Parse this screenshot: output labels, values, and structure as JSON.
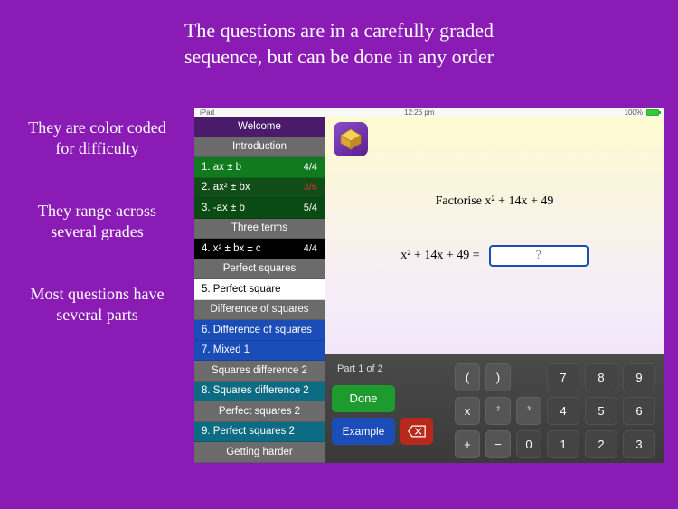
{
  "headline_l1": "The questions are in a carefully graded",
  "headline_l2": "sequence, but can be done in any order",
  "blurbs": {
    "b1": "They are color coded for difficulty",
    "b2": "They range across several grades",
    "b3": "Most questions have several parts"
  },
  "statusbar": {
    "device": "iPad",
    "wifi": "●",
    "time": "12:26 pm",
    "battery": "100%"
  },
  "sidebar": {
    "welcome": "Welcome",
    "sections": [
      {
        "header": "Introduction",
        "items": [
          {
            "label": "1. ax ± b",
            "score": "4/4",
            "color": "green"
          },
          {
            "label": "2. ax² ± bx",
            "score": "3/6",
            "scoreRed": true,
            "color": "darkgreen"
          },
          {
            "label": "3. -ax ± b",
            "score": "5/4",
            "color": "deepgreen"
          }
        ]
      },
      {
        "header": "Three terms",
        "items": [
          {
            "label": "4. x² ± bx ± c",
            "score": "4/4",
            "color": "black"
          }
        ]
      },
      {
        "header": "Perfect squares",
        "items": [
          {
            "label": "5. Perfect square",
            "color": "white"
          }
        ]
      },
      {
        "header": "Difference of squares",
        "items": [
          {
            "label": "6. Difference of squares",
            "color": "blue"
          },
          {
            "label": "7. Mixed 1",
            "color": "blue"
          }
        ]
      },
      {
        "header": "Squares difference 2",
        "items": [
          {
            "label": "8. Squares difference 2",
            "color": "teal"
          }
        ]
      },
      {
        "header": "Perfect squares 2",
        "items": [
          {
            "label": "9. Perfect squares 2",
            "color": "teal"
          }
        ]
      },
      {
        "header": "Getting harder",
        "items": []
      }
    ]
  },
  "question": {
    "prompt": "Factorise  x² + 14x + 49",
    "lhs": "x² + 14x + 49  =",
    "placeholder": "?"
  },
  "bottom": {
    "part": "Part 1 of 2",
    "done": "Done",
    "example": "Example"
  },
  "keypad": {
    "row1": [
      "(",
      ")",
      "",
      "7",
      "8",
      "9"
    ],
    "row2": [
      "x",
      "²",
      "³",
      "4",
      "5",
      "6"
    ],
    "row3": [
      "+",
      "−",
      "0",
      "1",
      "2",
      "3"
    ]
  }
}
